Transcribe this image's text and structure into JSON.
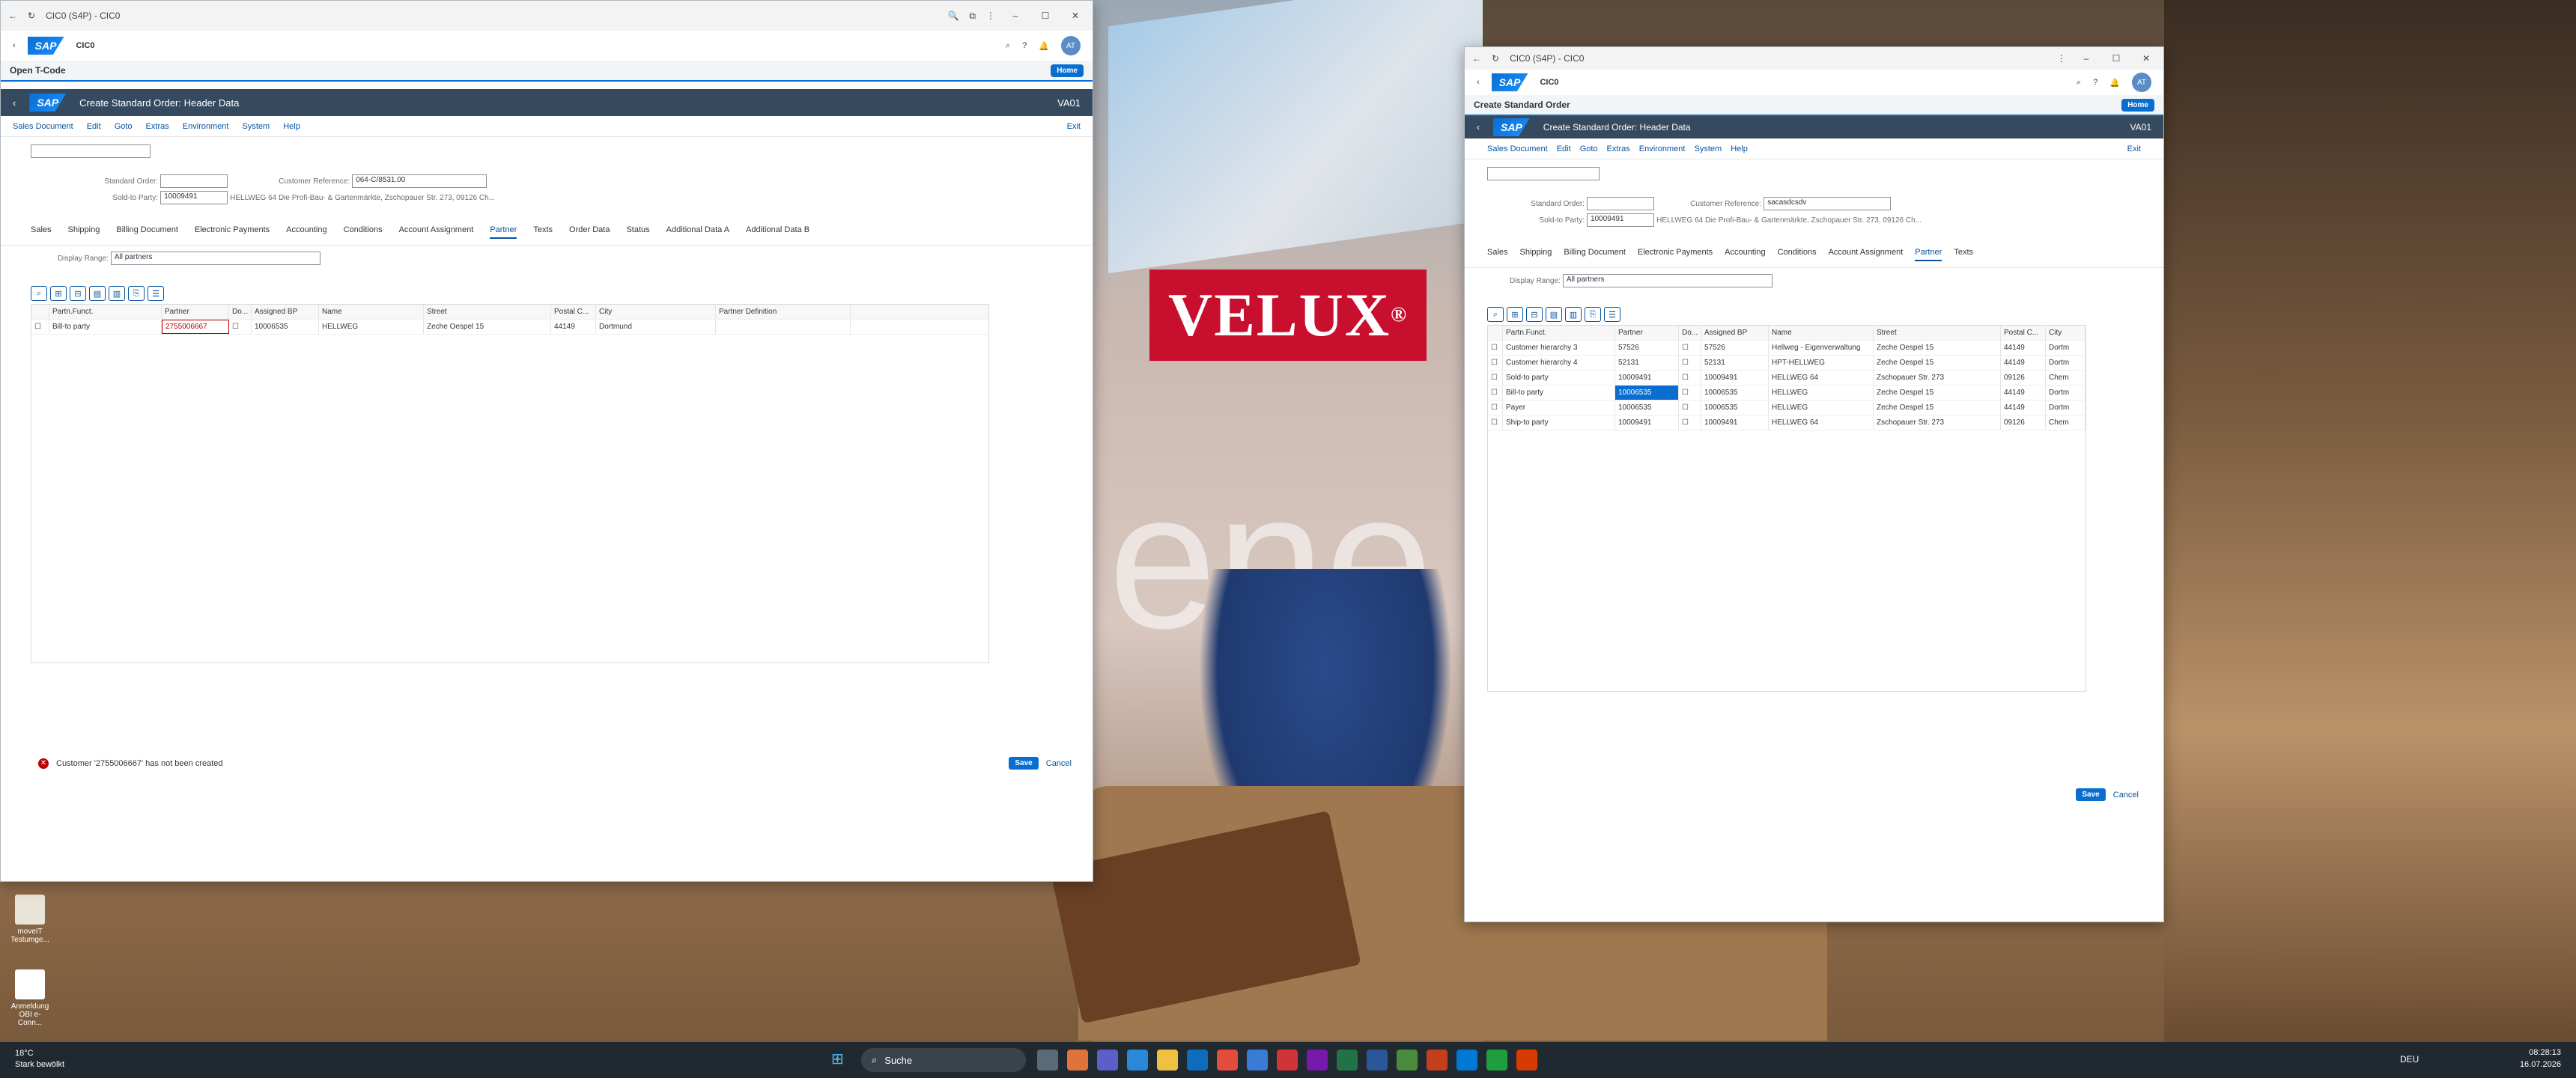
{
  "window1": {
    "title": "CIC0 (S4P) - CIC0",
    "shell_title": "CIC0",
    "avatar": "AT",
    "open_tcode": "Open T-Code",
    "home": "Home",
    "gui_title": "Create Standard Order: Header Data",
    "tcode": "VA01",
    "menu": [
      "Sales Document",
      "Edit",
      "Goto",
      "Extras",
      "Environment",
      "System",
      "Help"
    ],
    "exit": "Exit",
    "labels": {
      "standard_order": "Standard Order:",
      "customer_reference": "Customer Reference:",
      "sold_to": "Sold-to Party:"
    },
    "values": {
      "standard_order": "",
      "customer_reference": "064-C/8531.00",
      "sold_to": "10009491",
      "sold_to_desc": "HELLWEG 64 Die Profi-Bau- & Gartenmärkte, Zschopauer Str. 273, 09126 Ch..."
    },
    "tabs": [
      "Sales",
      "Shipping",
      "Billing Document",
      "Electronic Payments",
      "Accounting",
      "Conditions",
      "Account Assignment",
      "Partner",
      "Texts",
      "Order Data",
      "Status",
      "Additional Data A",
      "Additional Data B"
    ],
    "display_range_label": "Display Range:",
    "display_range": "All partners",
    "columns": [
      "Partn.Funct.",
      "Partner",
      "Do...",
      "Assigned BP",
      "Name",
      "Street",
      "Postal C...",
      "City",
      "Partner Definition"
    ],
    "rows": [
      {
        "func": "Bill-to party",
        "partner": "2755006667",
        "bp": "10006535",
        "name": "HELLWEG",
        "street": "Zeche Oespel 15",
        "postal": "44149",
        "city": "Dortmund"
      }
    ],
    "error": "Customer '2755006667' has not been created",
    "save": "Save",
    "cancel": "Cancel"
  },
  "window2": {
    "title": "CIC0 (S4P) - CIC0",
    "shell_title": "CIC0",
    "avatar": "AT",
    "page_title": "Create Standard Order",
    "home": "Home",
    "gui_title": "Create Standard Order: Header Data",
    "tcode": "VA01",
    "menu": [
      "Sales Document",
      "Edit",
      "Goto",
      "Extras",
      "Environment",
      "System",
      "Help"
    ],
    "exit": "Exit",
    "labels": {
      "standard_order": "Standard Order:",
      "customer_reference": "Customer Reference:",
      "sold_to": "Sold-to Party:"
    },
    "values": {
      "standard_order": "",
      "customer_reference": "sacasdcsdv",
      "sold_to": "10009491",
      "sold_to_desc": "HELLWEG 64 Die Profi-Bau- & Gartenmärkte, Zschopauer Str. 273, 09126 Ch..."
    },
    "tabs": [
      "Sales",
      "Shipping",
      "Billing Document",
      "Electronic Payments",
      "Accounting",
      "Conditions",
      "Account Assignment",
      "Partner",
      "Texts"
    ],
    "display_range_label": "Display Range:",
    "display_range": "All partners",
    "columns": [
      "Partn.Funct.",
      "Partner",
      "Do...",
      "Assigned BP",
      "Name",
      "Street",
      "Postal C...",
      "City"
    ],
    "rows": [
      {
        "func": "Customer hierarchy 3",
        "partner": "57526",
        "bp": "57526",
        "name": "Hellweg - Eigenverwaltung",
        "street": "Zeche Oespel 15",
        "postal": "44149",
        "city": "Dortm"
      },
      {
        "func": "Customer hierarchy 4",
        "partner": "52131",
        "bp": "52131",
        "name": "HPT-HELLWEG",
        "street": "Zeche Oespel 15",
        "postal": "44149",
        "city": "Dortm"
      },
      {
        "func": "Sold-to party",
        "partner": "10009491",
        "bp": "10009491",
        "name": "HELLWEG 64",
        "street": "Zschopauer Str. 273",
        "postal": "09126",
        "city": "Chem"
      },
      {
        "func": "Bill-to party",
        "partner": "10006535",
        "bp": "10006535",
        "name": "HELLWEG",
        "street": "Zeche Oespel 15",
        "postal": "44149",
        "city": "Dortm"
      },
      {
        "func": "Payer",
        "partner": "10006535",
        "bp": "10006535",
        "name": "HELLWEG",
        "street": "Zeche Oespel 15",
        "postal": "44149",
        "city": "Dortm"
      },
      {
        "func": "Ship-to party",
        "partner": "10009491",
        "bp": "10009491",
        "name": "HELLWEG 64",
        "street": "Zschopauer Str. 273",
        "postal": "09126",
        "city": "Chem"
      }
    ],
    "save": "Save",
    "cancel": "Cancel"
  },
  "desktop": {
    "brand": "VELUX",
    "icons": [
      {
        "label": "moveIT Testumge..."
      },
      {
        "label": "Anmeldung OBI e-Conn..."
      }
    ]
  },
  "taskbar": {
    "weather_temp": "18°C",
    "weather_desc": "Stark bewölkt",
    "search": "Suche",
    "lang": "DEU",
    "time": "08:28:13",
    "date": "16.07.2026"
  }
}
